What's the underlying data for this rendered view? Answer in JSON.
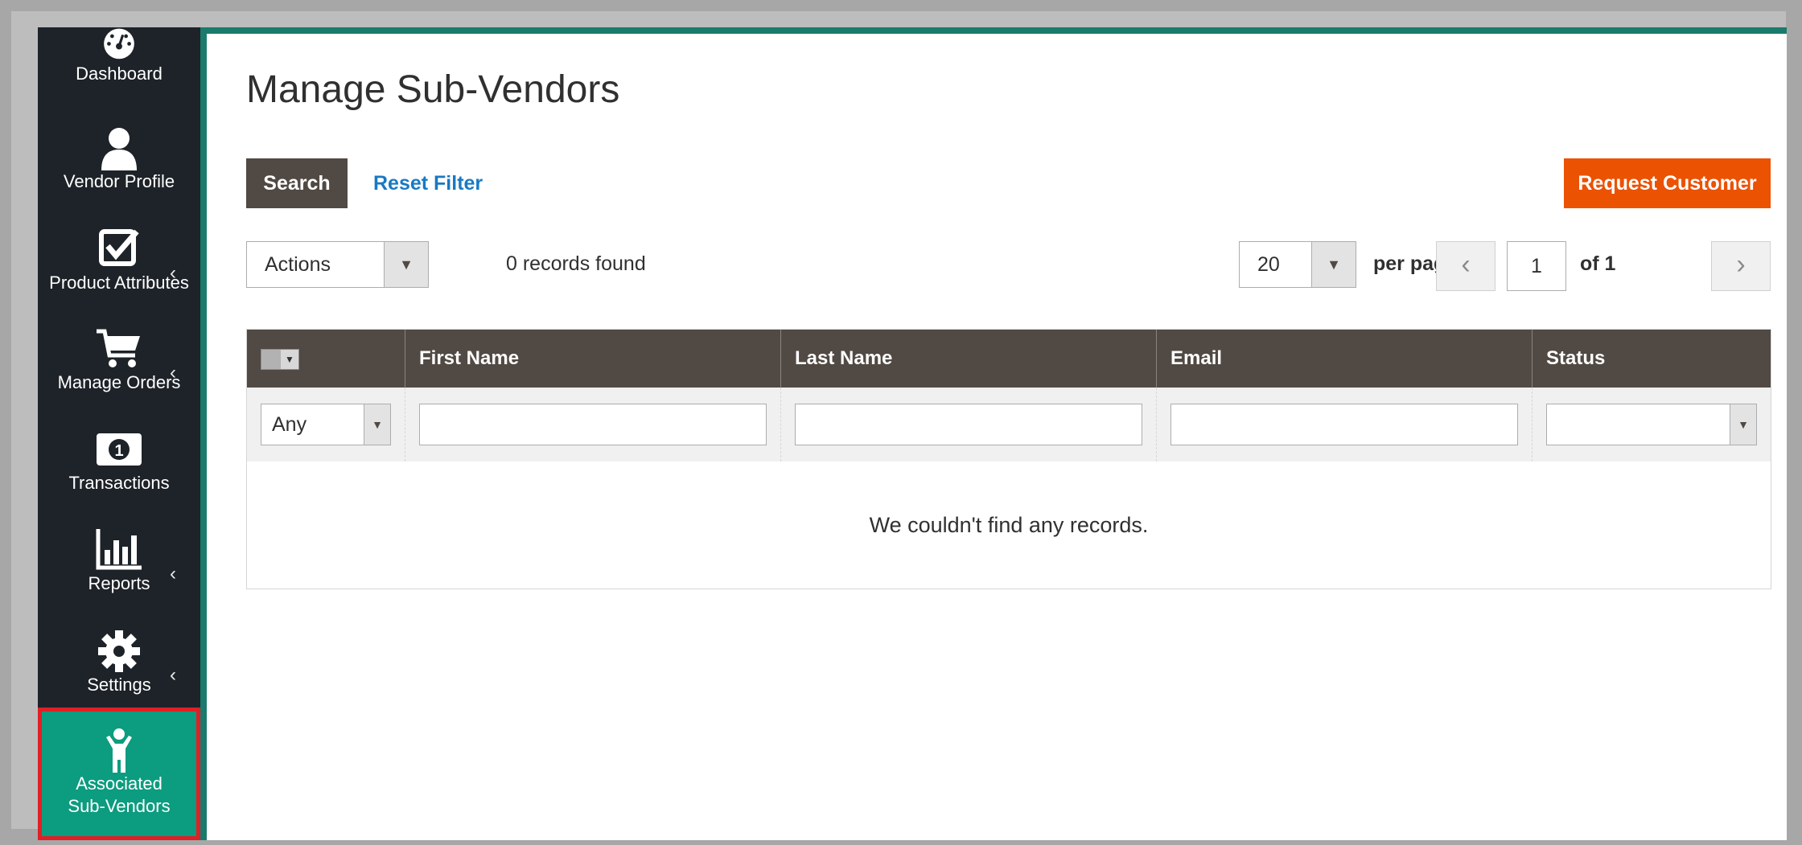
{
  "sidebar": {
    "items": [
      {
        "label": "Dashboard",
        "icon": "dashboard-gauge-icon",
        "has_submenu": false
      },
      {
        "label": "Vendor Profile",
        "icon": "user-icon",
        "has_submenu": false
      },
      {
        "label": "Product Attributes",
        "icon": "checkbox-icon",
        "has_submenu": true
      },
      {
        "label": "Manage Orders",
        "icon": "shopping-cart-icon",
        "has_submenu": true
      },
      {
        "label": "Transactions",
        "icon": "banknote-icon",
        "has_submenu": false
      },
      {
        "label": "Reports",
        "icon": "bar-chart-icon",
        "has_submenu": true
      },
      {
        "label": "Settings",
        "icon": "gear-icon",
        "has_submenu": true
      },
      {
        "label_line1": "Associated",
        "label_line2": "Sub-Vendors",
        "icon": "person-icon",
        "active": true
      }
    ],
    "chevron": "‹"
  },
  "main": {
    "title": "Manage Sub-Vendors",
    "search_label": "Search",
    "reset_filter_label": "Reset Filter",
    "request_customer_label": "Request Customer",
    "actions_value": "Actions",
    "records_found": "0 records found",
    "per_page_value": "20",
    "per_page_label": "per page",
    "current_page": "1",
    "of_pages": "of 1"
  },
  "grid": {
    "columns": [
      "First Name",
      "Last Name",
      "Email",
      "Status"
    ],
    "mass_select_filter": "Any",
    "empty_message": "We couldn't find any records."
  },
  "colors": {
    "sidebar_bg": "#1e2329",
    "accent_teal": "#1a7a6c",
    "active_item": "#0c9c7f",
    "highlight_border": "#e01f26",
    "header_bg": "#514943",
    "primary_button": "#eb5202",
    "link": "#1979c3"
  }
}
